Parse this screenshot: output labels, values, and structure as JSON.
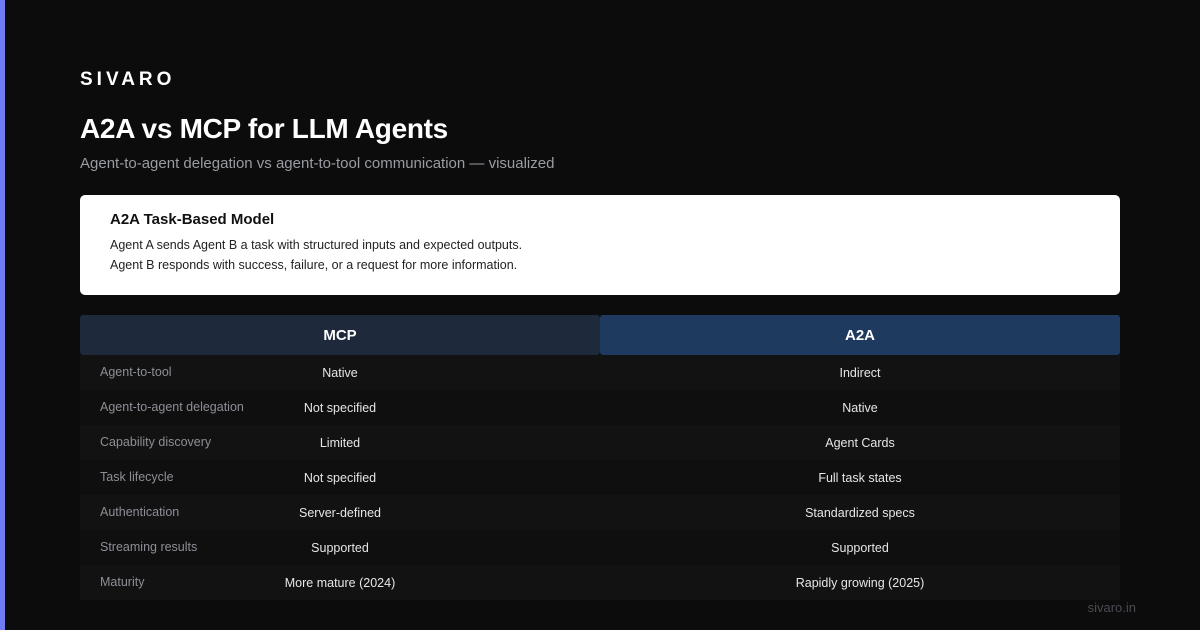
{
  "brand": "SIVARO",
  "title": "A2A vs MCP for LLM Agents",
  "subtitle": "Agent-to-agent delegation vs agent-to-tool communication — visualized",
  "card": {
    "title": "A2A Task-Based Model",
    "lines": [
      "Agent A sends Agent B a task with structured inputs and expected outputs.",
      "Agent B responds with success, failure, or a request for more information."
    ]
  },
  "table": {
    "headers": [
      "MCP",
      "A2A"
    ],
    "rows": [
      {
        "label": "Agent-to-tool",
        "mcp": "Native",
        "a2a": "Indirect"
      },
      {
        "label": "Agent-to-agent delegation",
        "mcp": "Not specified",
        "a2a": "Native"
      },
      {
        "label": "Capability discovery",
        "mcp": "Limited",
        "a2a": "Agent Cards"
      },
      {
        "label": "Task lifecycle",
        "mcp": "Not specified",
        "a2a": "Full task states"
      },
      {
        "label": "Authentication",
        "mcp": "Server-defined",
        "a2a": "Standardized specs"
      },
      {
        "label": "Streaming results",
        "mcp": "Supported",
        "a2a": "Supported"
      },
      {
        "label": "Maturity",
        "mcp": "More mature (2024)",
        "a2a": "Rapidly growing (2025)"
      }
    ]
  },
  "footer": "sivaro.in",
  "colors": {
    "background": "#0c0c0c",
    "accent": "#6e7bf2",
    "mcp_header": "#1e293b",
    "a2a_header": "#1e3a5f"
  }
}
